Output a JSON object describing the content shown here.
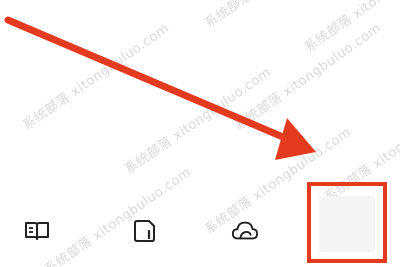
{
  "watermark": {
    "text": "系统部落 xitongbuluo.com",
    "color": "#d9d9d9"
  },
  "annotation": {
    "arrow_color": "#e43a1f",
    "box_color": "#e43a1f"
  },
  "toolbar": {
    "items": [
      {
        "icon": "book-icon",
        "label": ""
      },
      {
        "icon": "page-icon",
        "label": ""
      },
      {
        "icon": "cloud-icon",
        "label": ""
      },
      {
        "icon": "empty-slot",
        "label": ""
      }
    ]
  }
}
